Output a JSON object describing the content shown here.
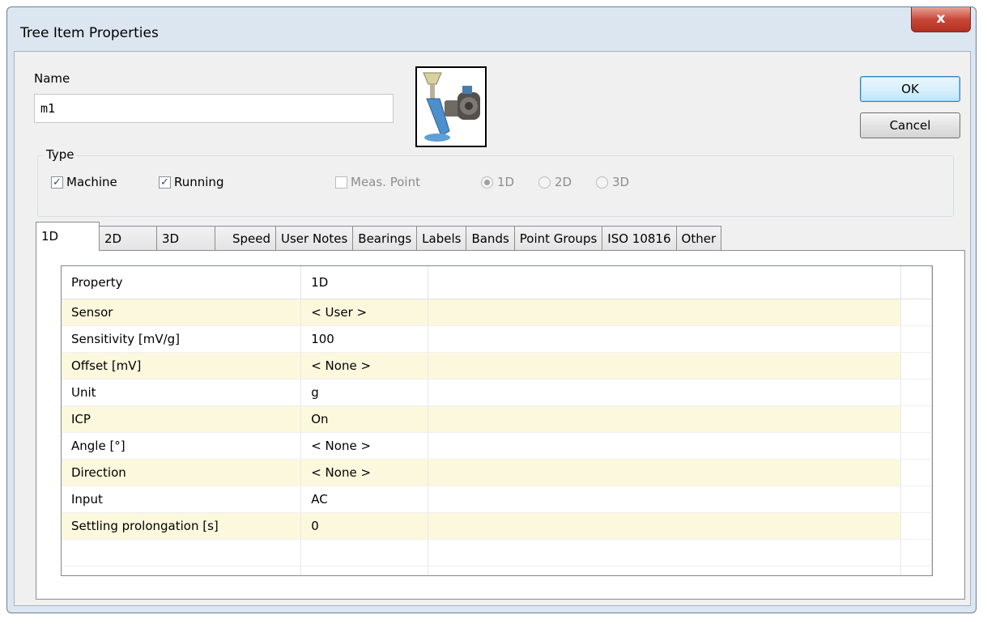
{
  "window": {
    "title": "Tree Item Properties",
    "close_label": "x"
  },
  "name": {
    "label": "Name",
    "value": "m1"
  },
  "buttons": {
    "ok": "OK",
    "cancel": "Cancel"
  },
  "type": {
    "title": "Type",
    "machine": {
      "label": "Machine",
      "checked": true
    },
    "running": {
      "label": "Running",
      "checked": true
    },
    "meas_point": {
      "label": "Meas. Point",
      "checked": false,
      "disabled": true
    },
    "radios": [
      {
        "label": "1D",
        "selected": true
      },
      {
        "label": "2D",
        "selected": false
      },
      {
        "label": "3D",
        "selected": false
      }
    ]
  },
  "tabs": [
    "1D",
    "2D",
    "3D",
    "Speed",
    "User Notes",
    "Bearings",
    "Labels",
    "Bands",
    "Point Groups",
    "ISO 10816",
    "Other"
  ],
  "grid": {
    "headers": [
      "Property",
      "1D"
    ],
    "rows": [
      {
        "property": "Sensor",
        "value": "< User >"
      },
      {
        "property": "Sensitivity [mV/g]",
        "value": "100"
      },
      {
        "property": "Offset [mV]",
        "value": "< None >"
      },
      {
        "property": "Unit",
        "value": "g"
      },
      {
        "property": "ICP",
        "value": "On"
      },
      {
        "property": "Angle [°]",
        "value": "< None >"
      },
      {
        "property": "Direction",
        "value": "< None >"
      },
      {
        "property": "Input",
        "value": "AC"
      },
      {
        "property": "Settling prolongation [s]",
        "value": "0"
      }
    ]
  },
  "colors": {
    "row_highlight": "#fcf8dd",
    "close_button": "#c7493a"
  }
}
